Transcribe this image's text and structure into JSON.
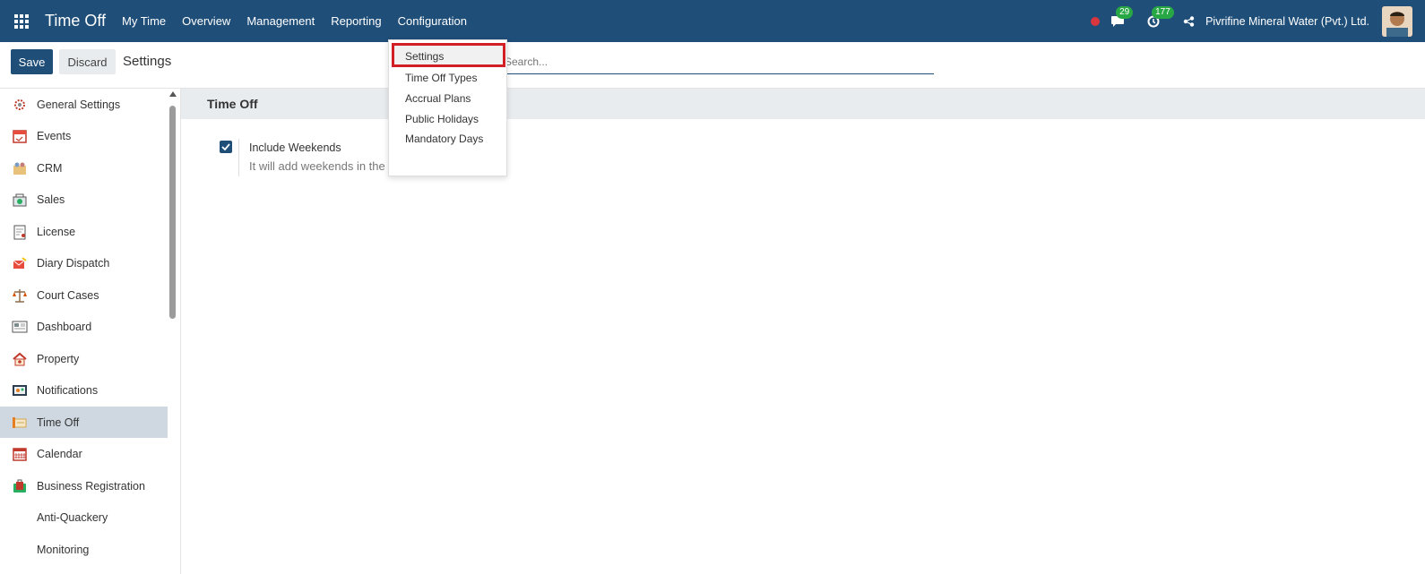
{
  "navbar": {
    "app_title": "Time Off",
    "menu": [
      "My Time",
      "Overview",
      "Management",
      "Reporting",
      "Configuration"
    ],
    "messages_count": "29",
    "activities_count": "177",
    "company": "Pivrifine Mineral Water (Pvt.) Ltd."
  },
  "control_panel": {
    "save_label": "Save",
    "discard_label": "Discard",
    "breadcrumb": "Settings",
    "search_placeholder": "Search..."
  },
  "sidebar": {
    "items": [
      {
        "label": "General Settings",
        "icon": "gear-icon"
      },
      {
        "label": "Events",
        "icon": "calendar-event-icon"
      },
      {
        "label": "CRM",
        "icon": "crm-icon"
      },
      {
        "label": "Sales",
        "icon": "sales-icon"
      },
      {
        "label": "License",
        "icon": "license-icon"
      },
      {
        "label": "Diary Dispatch",
        "icon": "envelope-icon"
      },
      {
        "label": "Court Cases",
        "icon": "scales-icon"
      },
      {
        "label": "Dashboard",
        "icon": "dashboard-icon"
      },
      {
        "label": "Property",
        "icon": "house-icon"
      },
      {
        "label": "Notifications",
        "icon": "notification-icon"
      },
      {
        "label": "Time Off",
        "icon": "time-off-icon"
      },
      {
        "label": "Calendar",
        "icon": "calendar-icon"
      },
      {
        "label": "Business Registration",
        "icon": "briefcase-icon"
      },
      {
        "label": "Anti-Quackery",
        "icon": ""
      },
      {
        "label": "Monitoring",
        "icon": ""
      }
    ],
    "active": "Time Off"
  },
  "main": {
    "section_title": "Time Off",
    "setting_label": "Include Weekends",
    "setting_checked": true,
    "setting_help": "It will add weekends in the"
  },
  "dropdown": {
    "items": [
      "Settings",
      "Time Off Types",
      "Accrual Plans",
      "Public Holidays",
      "Mandatory Days"
    ],
    "highlighted": "Settings"
  },
  "colors": {
    "navbar": "#1f4e79",
    "highlight_border": "#d21f26",
    "badge": "#28a745"
  }
}
